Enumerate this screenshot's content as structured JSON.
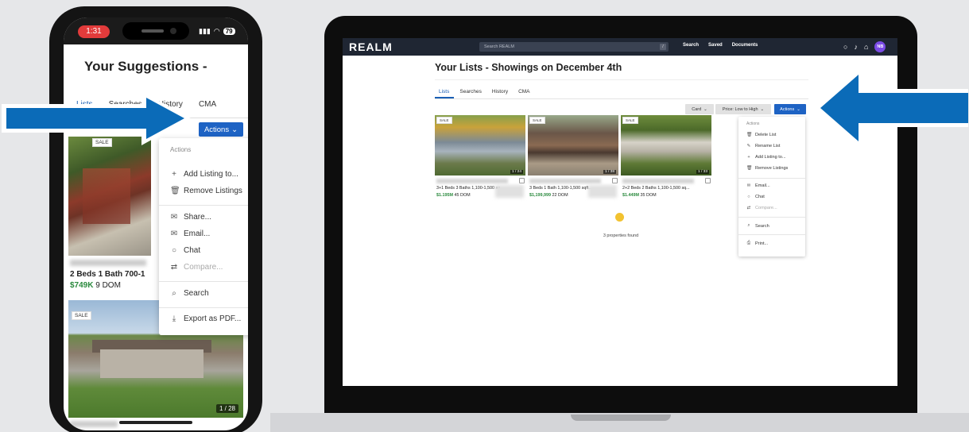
{
  "colors": {
    "brand_blue": "#1e63c4",
    "arrow_blue": "#0b6bb8",
    "price_green": "#2b8a3e",
    "nav_dark": "#1f2633",
    "avatar_purple": "#7b4be6"
  },
  "phone": {
    "status": {
      "time": "1:31",
      "battery": "79"
    },
    "title": "Your Suggestions -",
    "tabs": [
      "Lists",
      "Searches",
      "History",
      "CMA"
    ],
    "actions_label": "Actions",
    "menu": {
      "header": "Actions",
      "items": [
        {
          "icon": "plus-icon",
          "glyph": "+",
          "label": "Add Listing to..."
        },
        {
          "icon": "trash-icon",
          "glyph": "🗑",
          "label": "Remove Listings"
        },
        {
          "icon": "share-icon",
          "glyph": "✉",
          "label": "Share..."
        },
        {
          "icon": "email-icon",
          "glyph": "✉",
          "label": "Email..."
        },
        {
          "icon": "chat-icon",
          "glyph": "○",
          "label": "Chat"
        },
        {
          "icon": "compare-icon",
          "glyph": "⇄",
          "label": "Compare..."
        },
        {
          "icon": "search-icon",
          "glyph": "⌕",
          "label": "Search"
        },
        {
          "icon": "export-icon",
          "glyph": "⤓",
          "label": "Export as PDF..."
        }
      ]
    },
    "listing1": {
      "tag": "SALE",
      "beds": "2 Beds",
      "baths": "1 Bath",
      "size": "700-1",
      "price": "$749K",
      "dom": "9 DOM"
    },
    "listing2": {
      "tag": "SALE",
      "photo_count": "1 / 28"
    }
  },
  "desktop": {
    "logo": "REALM",
    "search_placeholder": "Search REALM",
    "search_shortcut": "/",
    "nav_links": [
      "Search",
      "Saved",
      "Documents"
    ],
    "avatar_initials": "NB",
    "title": "Your Lists - Showings on December 4th",
    "tabs": [
      "Lists",
      "Searches",
      "History",
      "CMA"
    ],
    "card_btn": "Card",
    "sort_btn": "Price: Low to High",
    "actions_btn": "Actions",
    "cards": [
      {
        "tag": "SALE",
        "count": "1 / 24",
        "beds": "3+1 Beds",
        "baths": "3 Baths",
        "size": "1,100-1,500 sq...",
        "price": "$1.195M",
        "dom": "45 DOM"
      },
      {
        "tag": "SALE",
        "count": "1 / 38",
        "beds": "3 Beds",
        "baths": "1 Bath",
        "size": "1,100-1,500 sqft...",
        "price": "$1,199,999",
        "dom": "22 DOM"
      },
      {
        "tag": "SALE",
        "count": "1 / 33",
        "beds": "2+2 Beds",
        "baths": "2 Baths",
        "size": "1,100-1,500 sq...",
        "price": "$1.449M",
        "dom": "35 DOM"
      }
    ],
    "found_text": "3 properties found",
    "menu": {
      "header": "Actions",
      "items": [
        {
          "icon": "trash-icon",
          "glyph": "🗑",
          "label": "Delete List"
        },
        {
          "icon": "edit-icon",
          "glyph": "✎",
          "label": "Rename List"
        },
        {
          "icon": "plus-icon",
          "glyph": "+",
          "label": "Add Listing to..."
        },
        {
          "icon": "trash-icon",
          "glyph": "🗑",
          "label": "Remove Listings"
        },
        {
          "icon": "email-icon",
          "glyph": "✉",
          "label": "Email..."
        },
        {
          "icon": "chat-icon",
          "glyph": "○",
          "label": "Chat"
        },
        {
          "icon": "compare-icon",
          "glyph": "⇄",
          "label": "Compare..."
        },
        {
          "icon": "search-icon",
          "glyph": "⌕",
          "label": "Search"
        },
        {
          "icon": "print-icon",
          "glyph": "⎙",
          "label": "Print..."
        }
      ]
    }
  }
}
